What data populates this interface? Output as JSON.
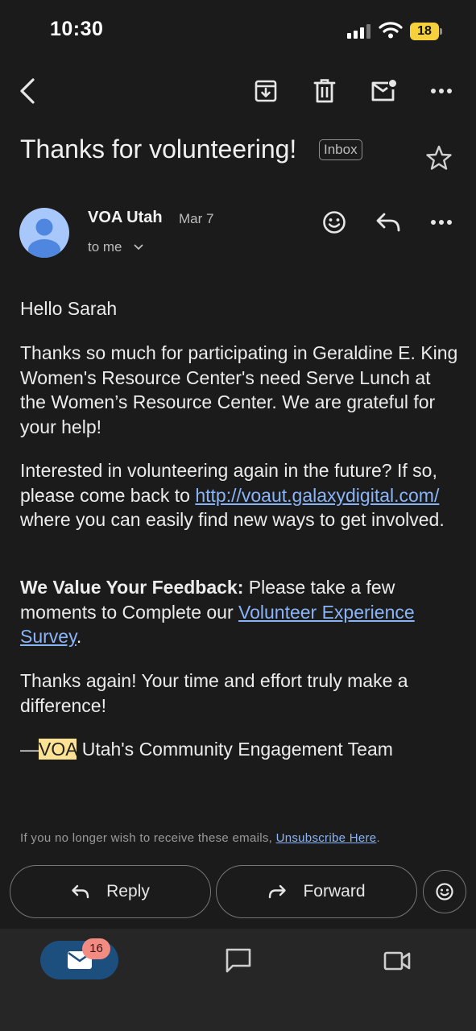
{
  "status_bar": {
    "time": "10:30",
    "battery": "18"
  },
  "email": {
    "subject": "Thanks for volunteering!",
    "label": "Inbox",
    "sender": "VOA Utah",
    "date": "Mar 7",
    "recipient": "to me",
    "greeting": "Hello Sarah",
    "para1": "Thanks so much for participating in Geraldine E. King Women's Resource Center's need Serve Lunch at the Women’s Resource Center. We are grateful for your help!",
    "para2_pre": "Interested in volunteering again in the future? If so, please come back to ",
    "para2_link": "http://voaut.galaxydigital.com/",
    "para2_post": " where you can easily find new ways to get involved.",
    "feedback_bold": "We Value Your Feedback:",
    "feedback_pre": " Please take a few moments to Complete our ",
    "feedback_link": "Volunteer Experience Survey",
    "feedback_post": ".",
    "para4": "Thanks again! Your time and effort truly make a difference!",
    "sign_dash": "—",
    "sign_highlight": "VOA",
    "sign_rest": " Utah's Community Engagement Team",
    "footer_text": "If you no longer wish to receive these emails, ",
    "footer_link": "Unsubscribe Here",
    "footer_end": "."
  },
  "actions": {
    "reply": "Reply",
    "forward": "Forward"
  },
  "bottom_nav": {
    "mail_badge": "16"
  },
  "icons": {
    "toolbar": [
      "back-icon",
      "archive-icon",
      "trash-icon",
      "mark-unread-icon",
      "more-icon"
    ],
    "accent": "#8ab4f8",
    "highlight": "#fde293"
  }
}
